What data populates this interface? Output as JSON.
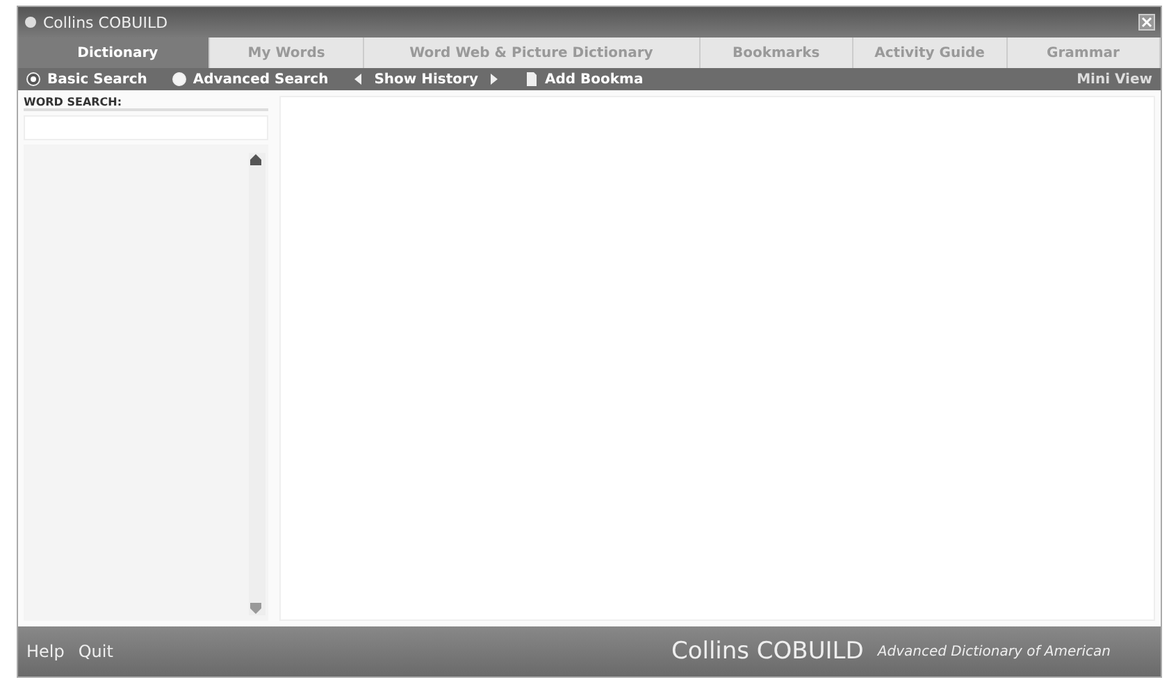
{
  "window": {
    "title": "Collins COBUILD"
  },
  "tabs": [
    {
      "label": "Dictionary",
      "selected": true
    },
    {
      "label": "My Words",
      "selected": false
    },
    {
      "label": "Word Web & Picture Dictionary",
      "selected": false
    },
    {
      "label": "Bookmarks",
      "selected": false
    },
    {
      "label": "Activity Guide",
      "selected": false
    },
    {
      "label": "Grammar",
      "selected": false
    }
  ],
  "toolbar": {
    "search_modes": [
      {
        "label": "Basic Search",
        "selected": true
      },
      {
        "label": "Advanced Search",
        "selected": false
      }
    ],
    "history": "Show History",
    "bookmark": "Add Bookma",
    "mini_view": "Mini View"
  },
  "word_search": {
    "label": "WORD SEARCH:"
  },
  "footer": {
    "links": [
      "Help",
      "Quit"
    ],
    "brand": "Collins COBUILD",
    "subtitle": "Advanced Dictionary of American"
  }
}
